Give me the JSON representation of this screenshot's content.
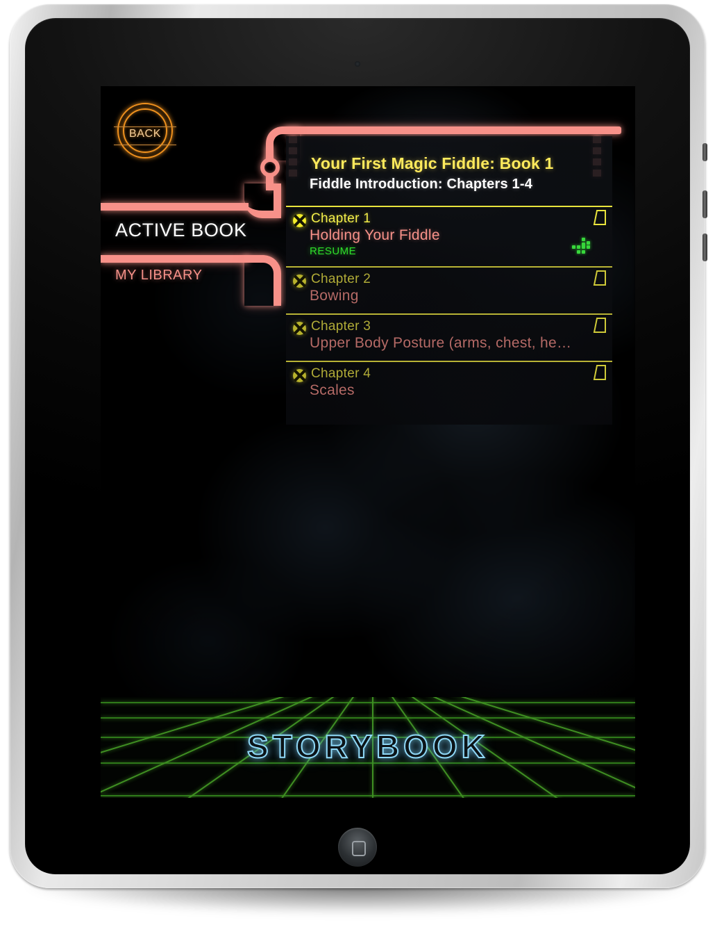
{
  "device": {
    "name": "tablet-frame",
    "home_button": "home-button",
    "camera": "front-camera"
  },
  "back_button": {
    "label": "BACK",
    "icon": "back-circle-icon",
    "color": "#f0921f"
  },
  "sidebar": {
    "items": [
      {
        "label": "ACTIVE BOOK",
        "state": "selected",
        "color": "#ffffff"
      },
      {
        "label": "MY LIBRARY",
        "state": "normal",
        "color": "#f79189"
      }
    ]
  },
  "book": {
    "title": "Your First Magic Fiddle: Book 1",
    "subtitle": "Fiddle Introduction: Chapters 1-4",
    "title_color": "#ffea5c",
    "subtitle_color": "#ffffff"
  },
  "chapters": [
    {
      "number": "Chapter 1",
      "name": "Holding Your Fiddle",
      "status": "RESUME",
      "active": true,
      "icon": "chapter-medallion-icon",
      "bookmark": "dog-ear-icon"
    },
    {
      "number": "Chapter 2",
      "name": "Bowing",
      "status": "",
      "active": false,
      "icon": "chapter-medallion-icon",
      "bookmark": "dog-ear-icon"
    },
    {
      "number": "Chapter 3",
      "name": "Upper Body Posture (arms, chest, he…",
      "status": "",
      "active": false,
      "icon": "chapter-medallion-icon",
      "bookmark": "dog-ear-icon"
    },
    {
      "number": "Chapter 4",
      "name": "Scales",
      "status": "",
      "active": false,
      "icon": "chapter-medallion-icon",
      "bookmark": "dog-ear-icon"
    }
  ],
  "footer": {
    "wordmark": "STORYBOOK",
    "wordmark_color": "#8fd8f7",
    "grid_color": "#3f8f22"
  },
  "accents": {
    "pink_rail": "#f79189",
    "yellow_rule": "#e9e43c",
    "resume_green": "#2ede2a"
  }
}
